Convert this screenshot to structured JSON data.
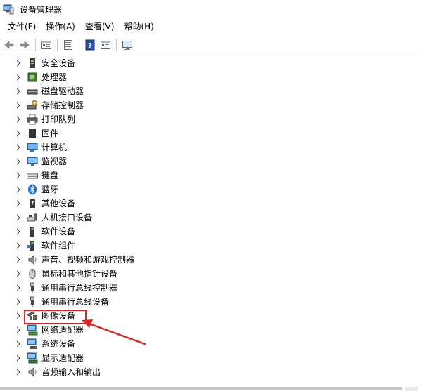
{
  "window": {
    "title": "设备管理器",
    "app_icon": "device-manager-icon"
  },
  "menu": [
    {
      "label": "文件(F)",
      "name": "menu-file"
    },
    {
      "label": "操作(A)",
      "name": "menu-action"
    },
    {
      "label": "查看(V)",
      "name": "menu-view"
    },
    {
      "label": "帮助(H)",
      "name": "menu-help"
    }
  ],
  "toolbar": [
    {
      "icon": "back-arrow-icon"
    },
    {
      "icon": "forward-arrow-icon"
    },
    {
      "icon": "properties-icon"
    },
    {
      "icon": "show-hide-console-tree-icon"
    },
    {
      "icon": "help-icon"
    },
    {
      "icon": "view-icon"
    },
    {
      "icon": "monitor-icon"
    }
  ],
  "tree_items": [
    {
      "label": "安全设备",
      "icon": "security-device-icon"
    },
    {
      "label": "处理器",
      "icon": "processor-icon"
    },
    {
      "label": "磁盘驱动器",
      "icon": "disk-drive-icon"
    },
    {
      "label": "存储控制器",
      "icon": "storage-controller-icon"
    },
    {
      "label": "打印队列",
      "icon": "print-queue-icon"
    },
    {
      "label": "固件",
      "icon": "firmware-icon"
    },
    {
      "label": "计算机",
      "icon": "computer-icon"
    },
    {
      "label": "监视器",
      "icon": "monitor-icon"
    },
    {
      "label": "键盘",
      "icon": "keyboard-icon"
    },
    {
      "label": "蓝牙",
      "icon": "bluetooth-icon"
    },
    {
      "label": "其他设备",
      "icon": "other-devices-icon"
    },
    {
      "label": "人机接口设备",
      "icon": "hid-icon"
    },
    {
      "label": "软件设备",
      "icon": "software-device-icon"
    },
    {
      "label": "软件组件",
      "icon": "software-component-icon"
    },
    {
      "label": "声音、视频和游戏控制器",
      "icon": "sound-icon"
    },
    {
      "label": "鼠标和其他指针设备",
      "icon": "mouse-icon"
    },
    {
      "label": "通用串行总线控制器",
      "icon": "usb-icon"
    },
    {
      "label": "通用串行总线设备",
      "icon": "usb-device-icon"
    },
    {
      "label": "图像设备",
      "icon": "imaging-device-icon",
      "highlighted": true
    },
    {
      "label": "网络适配器",
      "icon": "network-adapter-icon"
    },
    {
      "label": "系统设备",
      "icon": "system-device-icon"
    },
    {
      "label": "显示适配器",
      "icon": "display-adapter-icon"
    },
    {
      "label": "音频输入和输出",
      "icon": "audio-io-icon"
    }
  ],
  "colors": {
    "highlight": "#e0241d",
    "arrow": "#e0241d"
  }
}
